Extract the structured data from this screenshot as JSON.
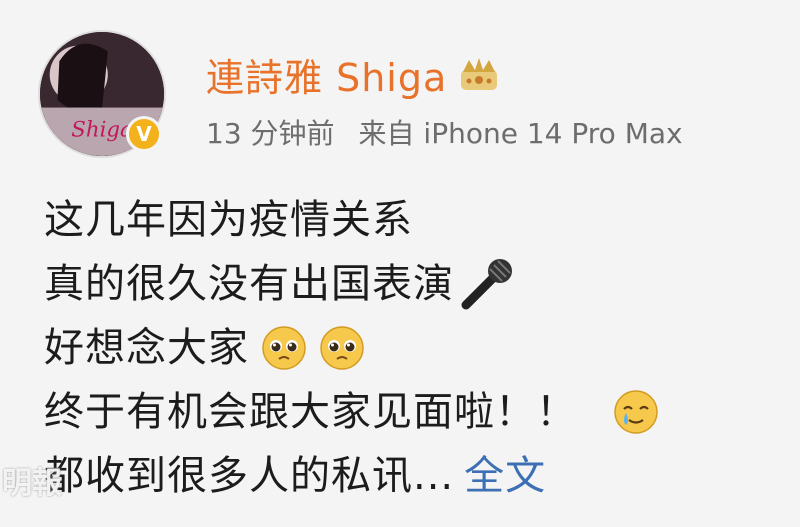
{
  "post": {
    "author": {
      "name": "連詩雅 Shiga",
      "avatar_text": "Shiga",
      "verified_mark": "V",
      "badge_icon": "crown-icon"
    },
    "meta": {
      "time": "13 分钟前",
      "source": "来自 iPhone 14 Pro Max"
    },
    "lines": [
      "这几年因为疫情关系",
      "真的很久没有出国表演",
      "好想念大家",
      "终于有机会跟大家见面啦！！",
      "都收到很多人的私讯..."
    ],
    "more_label": "全文",
    "emojis": {
      "line2": "microphone-icon",
      "line3": [
        "pleading-face-icon",
        "pleading-face-icon"
      ],
      "line4": "crying-smile-icon"
    }
  },
  "watermark": "明報",
  "colors": {
    "username": "#e8722a",
    "link": "#3d6fb4",
    "meta": "#6d6d6d",
    "verified": "#f3b21c"
  }
}
